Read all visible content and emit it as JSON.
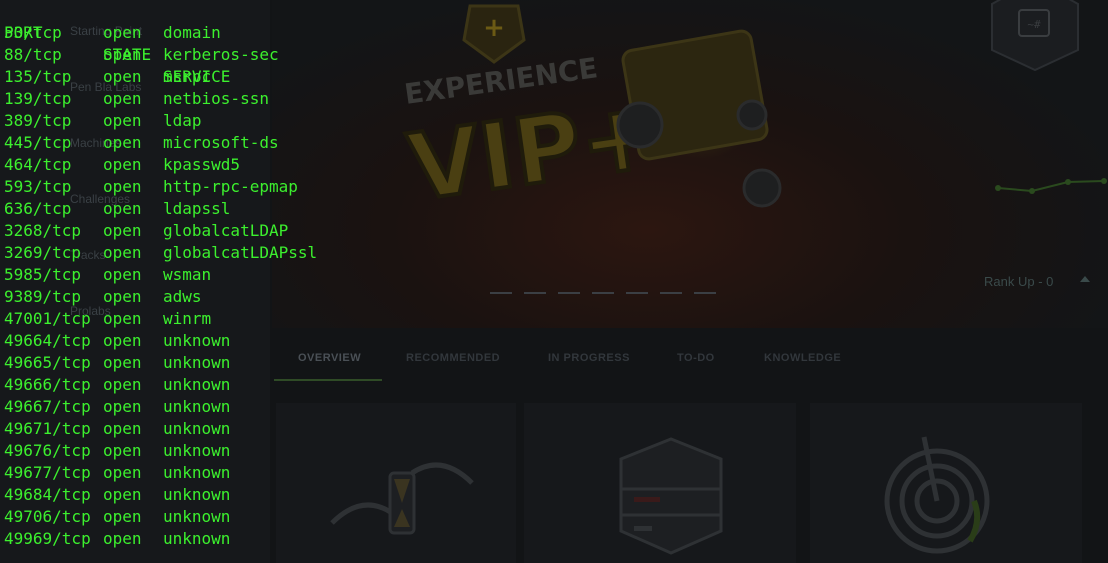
{
  "background_page": {
    "sidebar_items": [
      {
        "label": "Starting Point"
      },
      {
        "label": "Pen Bla Labs"
      },
      {
        "label": "Machines"
      },
      {
        "label": "Challenges"
      },
      {
        "label": "Tracks"
      },
      {
        "label": "Prolabs"
      }
    ],
    "promo": {
      "headline": "EXPERIENCE",
      "logo_text": "VIP+"
    },
    "hexagon_glyph": "~#",
    "rank_text": "Rank Up - 0",
    "tabs": [
      {
        "label": "OVERVIEW",
        "active": true
      },
      {
        "label": "RECOMMENDED",
        "active": false
      },
      {
        "label": "IN PROGRESS",
        "active": false
      },
      {
        "label": "TO-DO",
        "active": false
      },
      {
        "label": "KNOWLEDGE",
        "active": false
      }
    ],
    "cards": [
      {
        "icon": "hourglass-hands-icon"
      },
      {
        "icon": "server-stack-icon"
      },
      {
        "icon": "maze-target-icon"
      }
    ],
    "colors": {
      "accent_green": "#9fef00",
      "vip_yellow": "#f7c325"
    }
  },
  "terminal": {
    "text_color": "#3cf02e",
    "header": {
      "port": "PORT",
      "state": "STATE",
      "service": "SERVICE"
    },
    "rows": [
      {
        "port": "53/tcp",
        "state": "open",
        "service": "domain"
      },
      {
        "port": "88/tcp",
        "state": "open",
        "service": "kerberos-sec"
      },
      {
        "port": "135/tcp",
        "state": "open",
        "service": "msrpc"
      },
      {
        "port": "139/tcp",
        "state": "open",
        "service": "netbios-ssn"
      },
      {
        "port": "389/tcp",
        "state": "open",
        "service": "ldap"
      },
      {
        "port": "445/tcp",
        "state": "open",
        "service": "microsoft-ds"
      },
      {
        "port": "464/tcp",
        "state": "open",
        "service": "kpasswd5"
      },
      {
        "port": "593/tcp",
        "state": "open",
        "service": "http-rpc-epmap"
      },
      {
        "port": "636/tcp",
        "state": "open",
        "service": "ldapssl"
      },
      {
        "port": "3268/tcp",
        "state": "open",
        "service": "globalcatLDAP"
      },
      {
        "port": "3269/tcp",
        "state": "open",
        "service": "globalcatLDAPssl"
      },
      {
        "port": "5985/tcp",
        "state": "open",
        "service": "wsman"
      },
      {
        "port": "9389/tcp",
        "state": "open",
        "service": "adws"
      },
      {
        "port": "47001/tcp",
        "state": "open",
        "service": "winrm"
      },
      {
        "port": "49664/tcp",
        "state": "open",
        "service": "unknown"
      },
      {
        "port": "49665/tcp",
        "state": "open",
        "service": "unknown"
      },
      {
        "port": "49666/tcp",
        "state": "open",
        "service": "unknown"
      },
      {
        "port": "49667/tcp",
        "state": "open",
        "service": "unknown"
      },
      {
        "port": "49671/tcp",
        "state": "open",
        "service": "unknown"
      },
      {
        "port": "49676/tcp",
        "state": "open",
        "service": "unknown"
      },
      {
        "port": "49677/tcp",
        "state": "open",
        "service": "unknown"
      },
      {
        "port": "49684/tcp",
        "state": "open",
        "service": "unknown"
      },
      {
        "port": "49706/tcp",
        "state": "open",
        "service": "unknown"
      },
      {
        "port": "49969/tcp",
        "state": "open",
        "service": "unknown"
      }
    ]
  }
}
